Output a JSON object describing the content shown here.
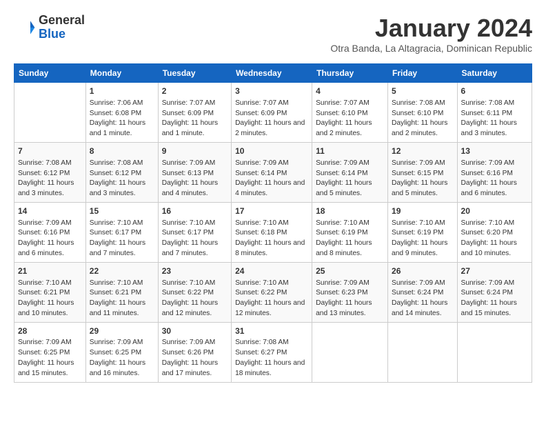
{
  "logo": {
    "general": "General",
    "blue": "Blue"
  },
  "title": "January 2024",
  "subtitle": "Otra Banda, La Altagracia, Dominican Republic",
  "headers": [
    "Sunday",
    "Monday",
    "Tuesday",
    "Wednesday",
    "Thursday",
    "Friday",
    "Saturday"
  ],
  "weeks": [
    [
      {
        "day": "",
        "sunrise": "",
        "sunset": "",
        "daylight": ""
      },
      {
        "day": "1",
        "sunrise": "Sunrise: 7:06 AM",
        "sunset": "Sunset: 6:08 PM",
        "daylight": "Daylight: 11 hours and 1 minute."
      },
      {
        "day": "2",
        "sunrise": "Sunrise: 7:07 AM",
        "sunset": "Sunset: 6:09 PM",
        "daylight": "Daylight: 11 hours and 1 minute."
      },
      {
        "day": "3",
        "sunrise": "Sunrise: 7:07 AM",
        "sunset": "Sunset: 6:09 PM",
        "daylight": "Daylight: 11 hours and 2 minutes."
      },
      {
        "day": "4",
        "sunrise": "Sunrise: 7:07 AM",
        "sunset": "Sunset: 6:10 PM",
        "daylight": "Daylight: 11 hours and 2 minutes."
      },
      {
        "day": "5",
        "sunrise": "Sunrise: 7:08 AM",
        "sunset": "Sunset: 6:10 PM",
        "daylight": "Daylight: 11 hours and 2 minutes."
      },
      {
        "day": "6",
        "sunrise": "Sunrise: 7:08 AM",
        "sunset": "Sunset: 6:11 PM",
        "daylight": "Daylight: 11 hours and 3 minutes."
      }
    ],
    [
      {
        "day": "7",
        "sunrise": "Sunrise: 7:08 AM",
        "sunset": "Sunset: 6:12 PM",
        "daylight": "Daylight: 11 hours and 3 minutes."
      },
      {
        "day": "8",
        "sunrise": "Sunrise: 7:08 AM",
        "sunset": "Sunset: 6:12 PM",
        "daylight": "Daylight: 11 hours and 3 minutes."
      },
      {
        "day": "9",
        "sunrise": "Sunrise: 7:09 AM",
        "sunset": "Sunset: 6:13 PM",
        "daylight": "Daylight: 11 hours and 4 minutes."
      },
      {
        "day": "10",
        "sunrise": "Sunrise: 7:09 AM",
        "sunset": "Sunset: 6:14 PM",
        "daylight": "Daylight: 11 hours and 4 minutes."
      },
      {
        "day": "11",
        "sunrise": "Sunrise: 7:09 AM",
        "sunset": "Sunset: 6:14 PM",
        "daylight": "Daylight: 11 hours and 5 minutes."
      },
      {
        "day": "12",
        "sunrise": "Sunrise: 7:09 AM",
        "sunset": "Sunset: 6:15 PM",
        "daylight": "Daylight: 11 hours and 5 minutes."
      },
      {
        "day": "13",
        "sunrise": "Sunrise: 7:09 AM",
        "sunset": "Sunset: 6:16 PM",
        "daylight": "Daylight: 11 hours and 6 minutes."
      }
    ],
    [
      {
        "day": "14",
        "sunrise": "Sunrise: 7:09 AM",
        "sunset": "Sunset: 6:16 PM",
        "daylight": "Daylight: 11 hours and 6 minutes."
      },
      {
        "day": "15",
        "sunrise": "Sunrise: 7:10 AM",
        "sunset": "Sunset: 6:17 PM",
        "daylight": "Daylight: 11 hours and 7 minutes."
      },
      {
        "day": "16",
        "sunrise": "Sunrise: 7:10 AM",
        "sunset": "Sunset: 6:17 PM",
        "daylight": "Daylight: 11 hours and 7 minutes."
      },
      {
        "day": "17",
        "sunrise": "Sunrise: 7:10 AM",
        "sunset": "Sunset: 6:18 PM",
        "daylight": "Daylight: 11 hours and 8 minutes."
      },
      {
        "day": "18",
        "sunrise": "Sunrise: 7:10 AM",
        "sunset": "Sunset: 6:19 PM",
        "daylight": "Daylight: 11 hours and 8 minutes."
      },
      {
        "day": "19",
        "sunrise": "Sunrise: 7:10 AM",
        "sunset": "Sunset: 6:19 PM",
        "daylight": "Daylight: 11 hours and 9 minutes."
      },
      {
        "day": "20",
        "sunrise": "Sunrise: 7:10 AM",
        "sunset": "Sunset: 6:20 PM",
        "daylight": "Daylight: 11 hours and 10 minutes."
      }
    ],
    [
      {
        "day": "21",
        "sunrise": "Sunrise: 7:10 AM",
        "sunset": "Sunset: 6:21 PM",
        "daylight": "Daylight: 11 hours and 10 minutes."
      },
      {
        "day": "22",
        "sunrise": "Sunrise: 7:10 AM",
        "sunset": "Sunset: 6:21 PM",
        "daylight": "Daylight: 11 hours and 11 minutes."
      },
      {
        "day": "23",
        "sunrise": "Sunrise: 7:10 AM",
        "sunset": "Sunset: 6:22 PM",
        "daylight": "Daylight: 11 hours and 12 minutes."
      },
      {
        "day": "24",
        "sunrise": "Sunrise: 7:10 AM",
        "sunset": "Sunset: 6:22 PM",
        "daylight": "Daylight: 11 hours and 12 minutes."
      },
      {
        "day": "25",
        "sunrise": "Sunrise: 7:09 AM",
        "sunset": "Sunset: 6:23 PM",
        "daylight": "Daylight: 11 hours and 13 minutes."
      },
      {
        "day": "26",
        "sunrise": "Sunrise: 7:09 AM",
        "sunset": "Sunset: 6:24 PM",
        "daylight": "Daylight: 11 hours and 14 minutes."
      },
      {
        "day": "27",
        "sunrise": "Sunrise: 7:09 AM",
        "sunset": "Sunset: 6:24 PM",
        "daylight": "Daylight: 11 hours and 15 minutes."
      }
    ],
    [
      {
        "day": "28",
        "sunrise": "Sunrise: 7:09 AM",
        "sunset": "Sunset: 6:25 PM",
        "daylight": "Daylight: 11 hours and 15 minutes."
      },
      {
        "day": "29",
        "sunrise": "Sunrise: 7:09 AM",
        "sunset": "Sunset: 6:25 PM",
        "daylight": "Daylight: 11 hours and 16 minutes."
      },
      {
        "day": "30",
        "sunrise": "Sunrise: 7:09 AM",
        "sunset": "Sunset: 6:26 PM",
        "daylight": "Daylight: 11 hours and 17 minutes."
      },
      {
        "day": "31",
        "sunrise": "Sunrise: 7:08 AM",
        "sunset": "Sunset: 6:27 PM",
        "daylight": "Daylight: 11 hours and 18 minutes."
      },
      {
        "day": "",
        "sunrise": "",
        "sunset": "",
        "daylight": ""
      },
      {
        "day": "",
        "sunrise": "",
        "sunset": "",
        "daylight": ""
      },
      {
        "day": "",
        "sunrise": "",
        "sunset": "",
        "daylight": ""
      }
    ]
  ]
}
